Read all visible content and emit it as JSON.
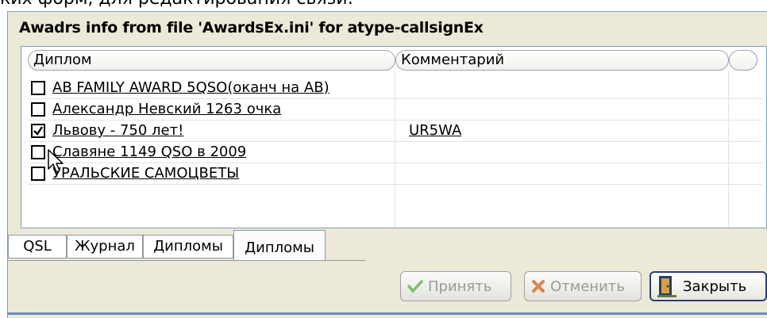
{
  "top_text": "ких форм, для редактирования связи:",
  "panel": {
    "title": "Awadrs info from file 'AwardsEx.ini' for atype-callsignEx"
  },
  "list": {
    "columns": [
      "Диплом",
      "Комментарий",
      ""
    ],
    "rows": [
      {
        "name": "AB FAMILY AWARD 5QSO(оканч на AB)",
        "comment": "",
        "checked": false
      },
      {
        "name": "Александр Невский 1263 очка",
        "comment": "",
        "checked": false
      },
      {
        "name": "Львову - 750 лет!",
        "comment": "UR5WA",
        "checked": true
      },
      {
        "name": "Славяне 1149 QSO в 2009",
        "comment": "",
        "checked": false
      },
      {
        "name": "УРАЛЬСКИЕ САМОЦВЕТЫ",
        "comment": "",
        "checked": false
      }
    ]
  },
  "tabs": [
    "QSL",
    "Журнал",
    "Дипломы",
    "Дипломы"
  ],
  "active_tab_index": 3,
  "buttons": {
    "accept": "Принять",
    "cancel": "Отменить",
    "close": "Закрыть"
  },
  "icons": {
    "accept": "checkmark-icon",
    "cancel": "x-icon",
    "close": "door-icon"
  },
  "colors": {
    "frame_bg": "#ece9d8",
    "border_blue": "#6a8cc0",
    "close_border": "#2d3f70"
  }
}
